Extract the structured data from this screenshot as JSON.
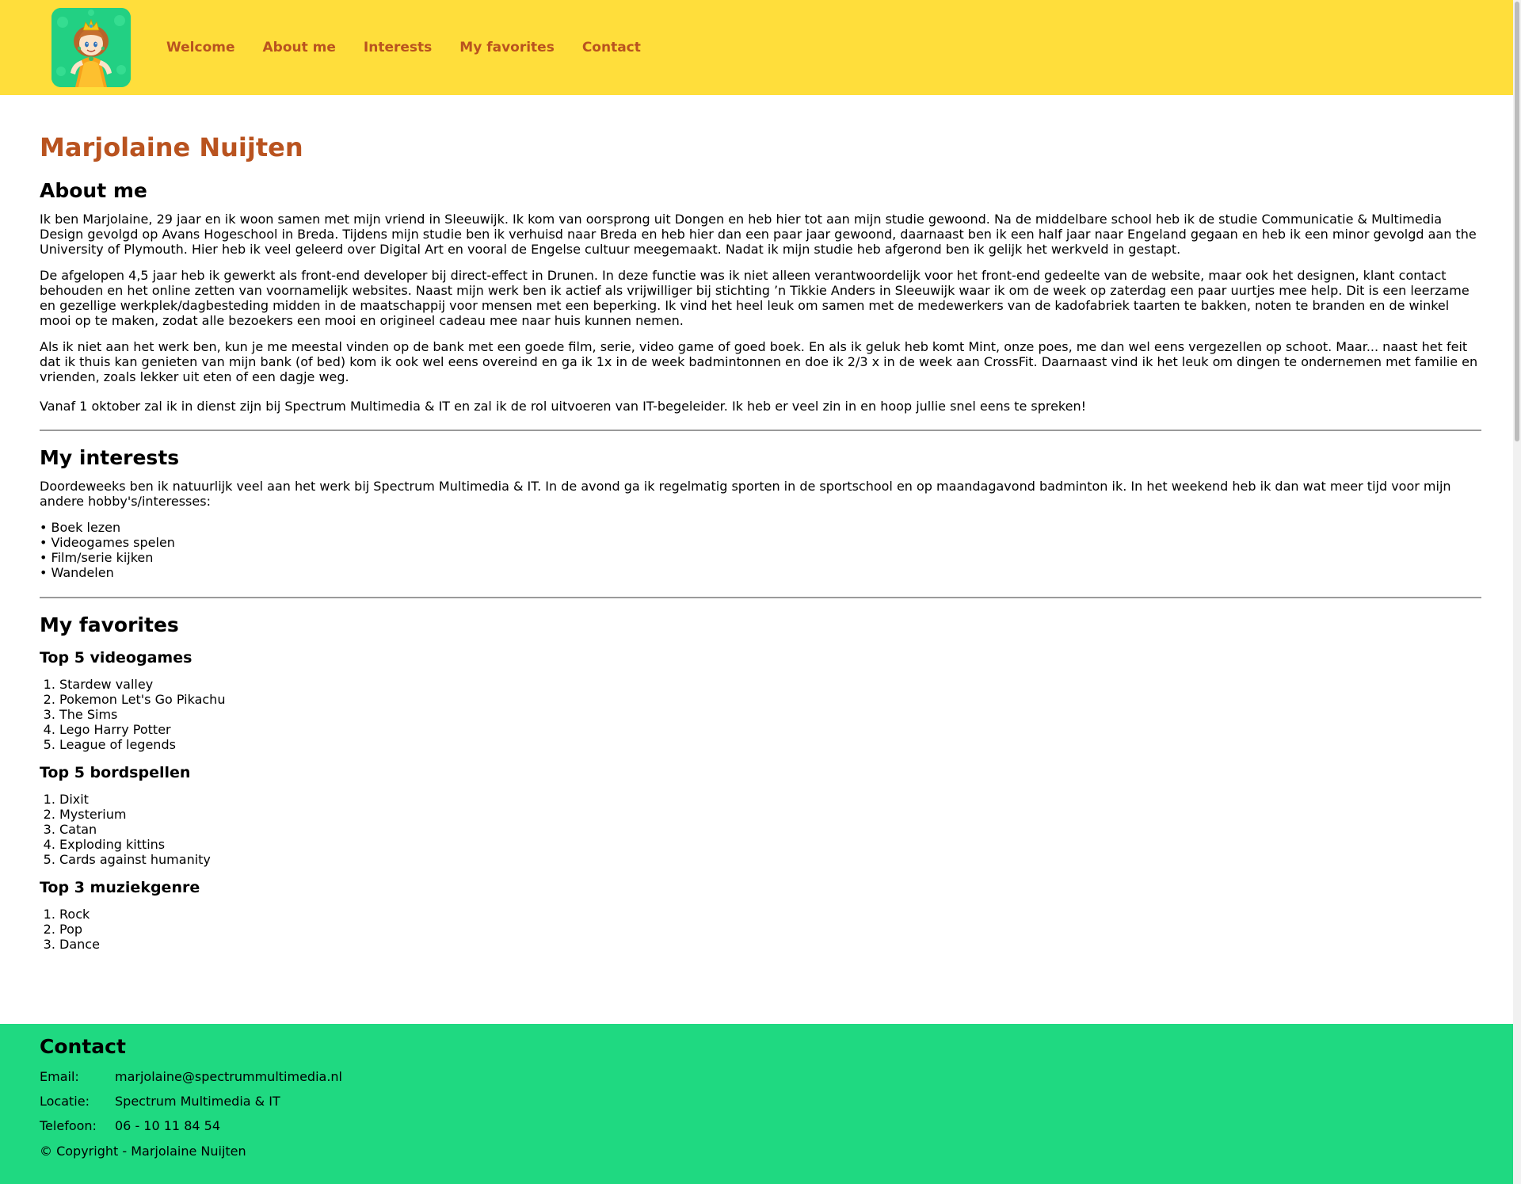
{
  "nav": {
    "items": [
      "Welcome",
      "About me",
      "Interests",
      "My favorites",
      "Contact"
    ]
  },
  "page": {
    "name": "Marjolaine Nuijten"
  },
  "about": {
    "heading": "About me",
    "paragraphs": [
      "Ik ben Marjolaine, 29 jaar en ik woon samen met mijn vriend in Sleeuwijk. Ik kom van oorsprong uit Dongen en heb hier tot aan mijn studie gewoond. Na de middelbare school heb ik de studie Communicatie & Multimedia Design gevolgd op Avans Hogeschool in Breda. Tijdens mijn studie ben ik verhuisd naar Breda en heb hier dan een paar jaar gewoond, daarnaast ben ik een half jaar naar Engeland gegaan en heb ik een minor gevolgd aan the University of Plymouth. Hier heb ik veel geleerd over Digital Art en vooral de Engelse cultuur meegemaakt. Nadat ik mijn studie heb afgerond ben ik gelijk het werkveld in gestapt.",
      "De afgelopen 4,5 jaar heb ik gewerkt als front-end developer bij direct-effect in Drunen. In deze functie was ik niet alleen verantwoordelijk voor het front-end gedeelte van de website, maar ook het designen, klant contact behouden en het online zetten van voornamelijk websites. Naast mijn werk ben ik actief als vrijwilliger bij stichting ’n Tikkie Anders in Sleeuwijk waar ik om de week op zaterdag een paar uurtjes mee help. Dit is een leerzame en gezellige werkplek/dagbesteding midden in de maatschappij voor mensen met een beperking. Ik vind het heel leuk om samen met de medewerkers van de kadofabriek taarten te bakken, noten te branden en de winkel mooi op te maken, zodat alle bezoekers een mooi en origineel cadeau mee naar huis kunnen nemen.",
      "Als ik niet aan het werk ben, kun je me meestal vinden op de bank met een goede film, serie, video game of goed boek. En als ik geluk heb komt Mint, onze poes, me dan wel eens vergezellen op schoot. Maar... naast het feit dat ik thuis kan genieten van mijn bank (of bed) kom ik ook wel eens overeind en ga ik 1x in de week badmintonnen en doe ik 2/3 x in de week aan CrossFit. Daarnaast vind ik het leuk om dingen te ondernemen met familie en vrienden, zoals lekker uit eten of een dagje weg.",
      "Vanaf 1 oktober zal ik in dienst zijn bij Spectrum Multimedia & IT en zal ik de rol uitvoeren van IT-begeleider. Ik heb er veel zin in en hoop jullie snel eens te spreken!"
    ]
  },
  "interests": {
    "heading": "My interests",
    "intro": "Doordeweeks ben ik natuurlijk veel aan het werk bij Spectrum Multimedia & IT. In de avond ga ik regelmatig sporten in de sportschool en op maandagavond badminton ik. In het weekend heb ik dan wat meer tijd voor mijn andere hobby's/interesses:",
    "items": [
      "Boek lezen",
      "Videogames spelen",
      "Film/serie kijken",
      "Wandelen"
    ]
  },
  "favorites": {
    "heading": "My favorites",
    "videogames": {
      "heading": "Top 5 videogames",
      "items": [
        "Stardew valley",
        "Pokemon Let's Go Pikachu",
        "The Sims",
        "Lego Harry Potter",
        "League of legends"
      ]
    },
    "boardgames": {
      "heading": "Top 5 bordspellen",
      "items": [
        "Dixit",
        "Mysterium",
        "Catan",
        "Exploding kittins",
        "Cards against humanity"
      ]
    },
    "music": {
      "heading": "Top 3 muziekgenre",
      "items": [
        "Rock",
        "Pop",
        "Dance"
      ]
    }
  },
  "contact": {
    "heading": "Contact",
    "email_label": "Email:",
    "email": "marjolaine@spectrummultimedia.nl",
    "location_label": "Locatie:",
    "location": "Spectrum Multimedia & IT",
    "phone_label": "Telefoon:",
    "phone": "06 - 10 11 84 54",
    "copyright": "© Copyright - Marjolaine Nuijten"
  },
  "colors": {
    "header_bg": "#FFDE3B",
    "accent": "#B9531F",
    "footer_bg": "#1FD981",
    "logo_bg": "#22D083"
  },
  "icons": {
    "logo": "princess-daisy-avatar"
  }
}
